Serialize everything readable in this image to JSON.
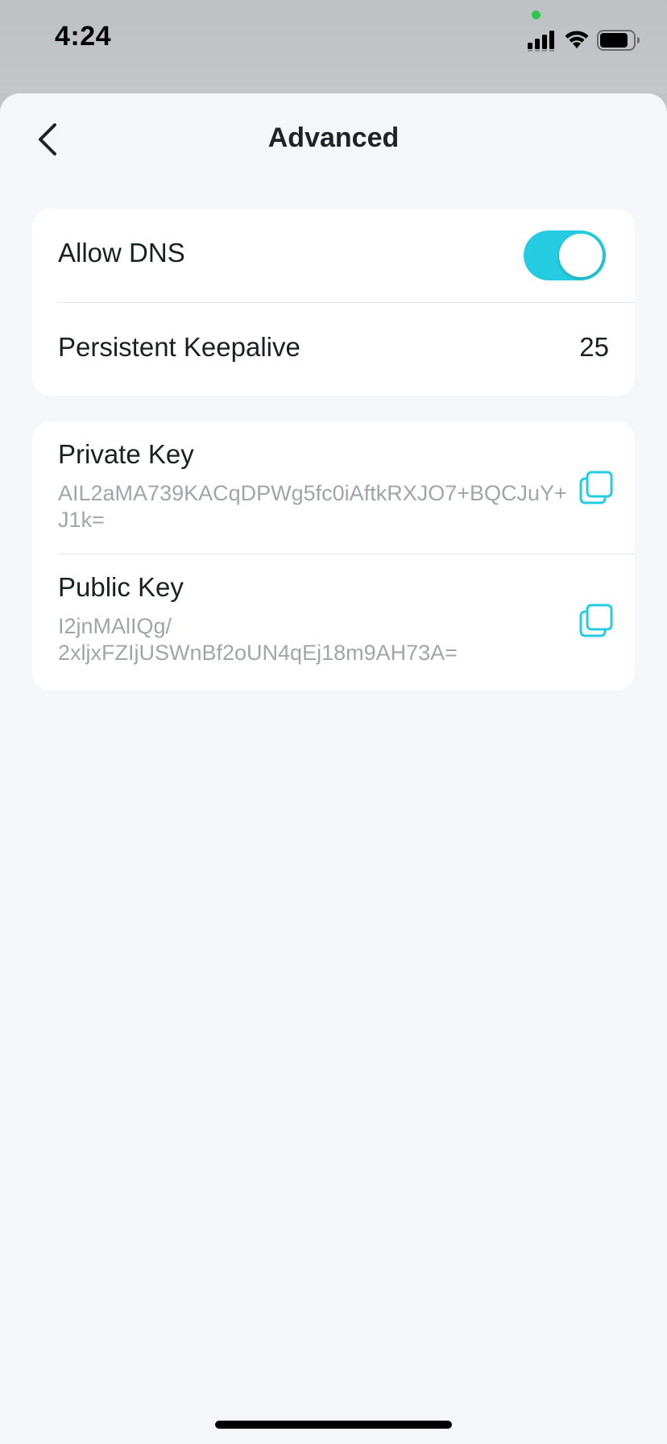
{
  "status_bar": {
    "time": "4:24"
  },
  "nav": {
    "title": "Advanced",
    "back_icon": "chevron-left-icon"
  },
  "settings": {
    "allow_dns": {
      "label": "Allow DNS",
      "enabled": true
    },
    "persistent_keepalive": {
      "label": "Persistent Keepalive",
      "value": "25"
    }
  },
  "keys": {
    "private_key": {
      "label": "Private Key",
      "value": "AIL2aMA739KACqDPWg5fc0iAftkRXJO7+BQCJuY+J1k="
    },
    "public_key": {
      "label": "Public Key",
      "value_line1": "I2jnMAlIQg/",
      "value_line2": "2xljxFZIjUSWnBf2oUN4qEj18m9AH73A="
    }
  },
  "colors": {
    "accent": "#25cbe0",
    "background": "#f4f6fa",
    "card": "#ffffff",
    "primary_text": "#1c1f24",
    "secondary_text": "#a1a5aa"
  },
  "icons": {
    "copy": "copy-icon",
    "wifi": "wifi-icon",
    "battery": "battery-icon",
    "signal": "cell-signal-icon"
  }
}
